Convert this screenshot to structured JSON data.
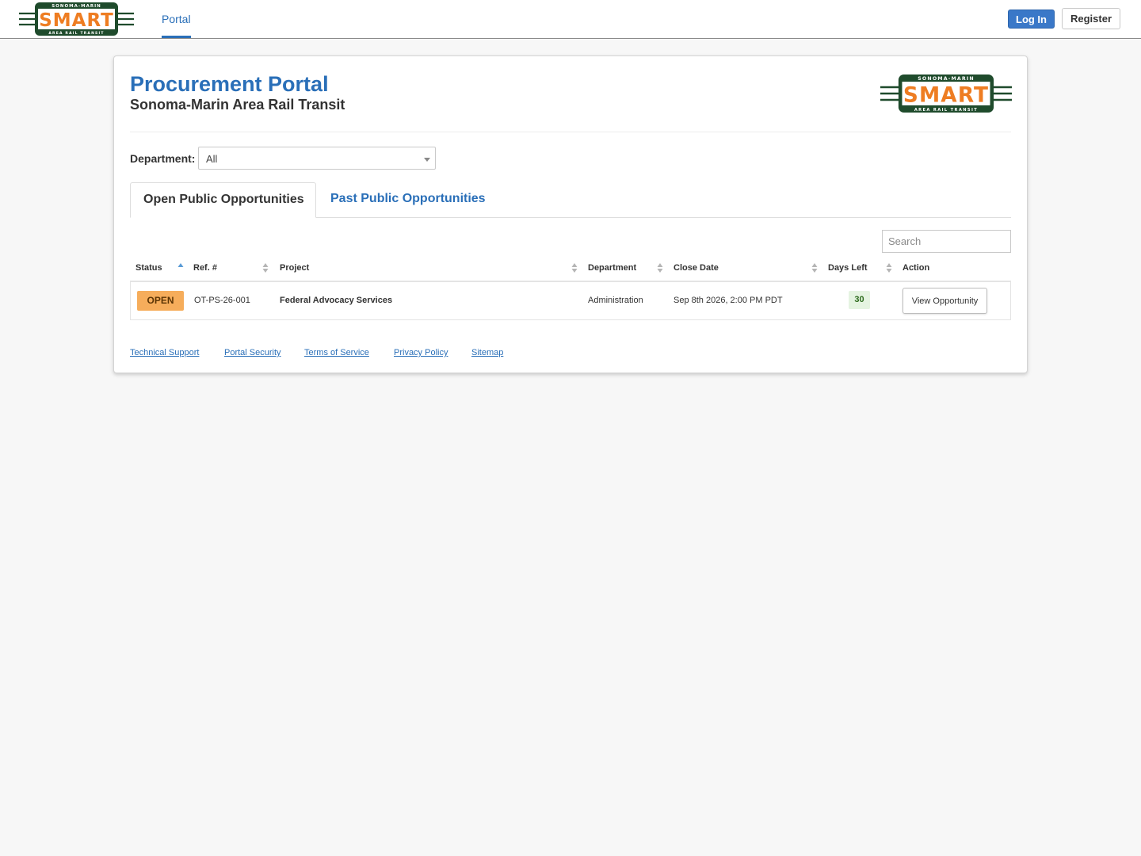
{
  "header": {
    "logo": {
      "top": "SONOMA-MARIN",
      "main": "SMART",
      "bottom": "AREA RAIL TRANSIT"
    },
    "nav_portal": "Portal",
    "login_label": "Log In",
    "register_label": "Register"
  },
  "page": {
    "title": "Procurement Portal",
    "subtitle": "Sonoma-Marin Area Rail Transit"
  },
  "filter": {
    "department_label": "Department:",
    "department_value": "All"
  },
  "tabs": [
    {
      "label": "Open Public Opportunities",
      "active": true
    },
    {
      "label": "Past Public Opportunities",
      "active": false
    }
  ],
  "search": {
    "placeholder": "Search"
  },
  "table": {
    "columns": [
      "Status",
      "Ref. #",
      "Project",
      "Department",
      "Close Date",
      "Days Left",
      "Action"
    ],
    "sorted_column": "Status",
    "sort_direction": "ascending",
    "rows": [
      {
        "status": "OPEN",
        "ref": "OT-PS-26-001",
        "project": "Federal Advocacy Services",
        "department": "Administration",
        "close_date": "Sep 8th 2026, 2:00 PM PDT",
        "days_left": "30",
        "action": "View Opportunity"
      }
    ]
  },
  "footer": {
    "links": [
      "Technical Support",
      "Portal Security",
      "Terms of Service",
      "Privacy Policy",
      "Sitemap"
    ]
  },
  "colors": {
    "brand_blue": "#2a6fb8",
    "logo_green": "#1f4b2c",
    "logo_orange": "#ee7d22",
    "status_open": "#f6ad5b",
    "days_left_bg": "#e5f4e1"
  }
}
